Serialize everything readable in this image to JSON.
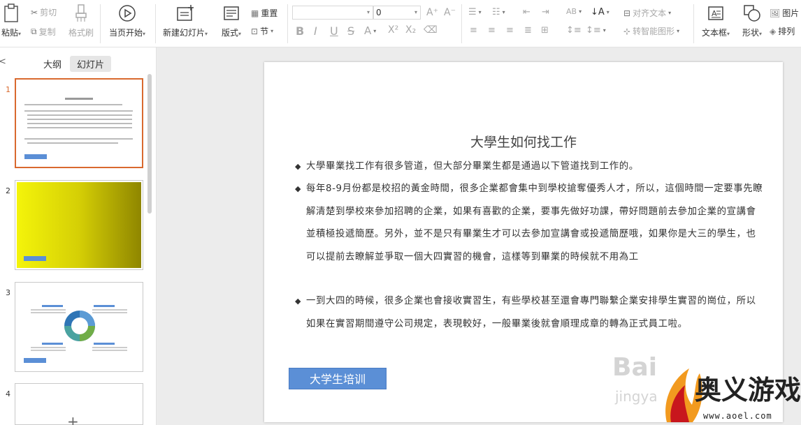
{
  "ribbon": {
    "paste": "粘贴",
    "cut": "剪切",
    "copy": "复制",
    "format_painter": "格式刷",
    "play_from_current": "当页开始",
    "new_slide": "新建幻灯片",
    "layout": "版式",
    "reset": "重置",
    "section": "节",
    "font_size": "0",
    "align_text": "对齐文本",
    "smart_art": "转智能图形",
    "text_box": "文本框",
    "shape": "形状",
    "picture": "图片",
    "arrange": "排列"
  },
  "panel": {
    "collapse": "<",
    "tabs": [
      "大纲",
      "幻灯片"
    ],
    "active_tab": "幻灯片",
    "slide_numbers": [
      "1",
      "2",
      "3",
      "4"
    ],
    "selected_slide": "1",
    "thumb_button": "大学生培训",
    "add_slide": "+"
  },
  "slide": {
    "title": "大學生如何找工作",
    "bullet_symbol": "◆",
    "bullets": [
      "大學畢業找工作有很多管道，但大部分畢業生都是通過以下管道找到工作的。",
      "每年8-9月份都是校招的黃金時間，很多企業都會集中到學校搶奪優秀人才，所以，這個時間一定要事先瞭解清楚到學校來參加招聘的企業，如果有喜歡的企業，要事先做好功課，帶好問題前去參加企業的宣講會並積極投遞簡歷。另外，並不是只有畢業生才可以去參加宣講會或投遞簡歷哦，如果你是大三的學生，也可以提前去瞭解並爭取一個大四實習的機會，這樣等到畢業的時候就不用為工",
      "一到大四的時候，很多企業也會接收實習生，有些學校甚至還會專門聯繫企業安排學生實習的崗位，所以如果在實習期間遵守公司規定，表現較好，一般畢業後就會順理成章的轉為正式員工啦。"
    ],
    "button": "大学生培训"
  },
  "watermark": {
    "baidu": "Bai",
    "jingyan": "jingya",
    "site_name": "奥义游戏网",
    "site_url": "www.aoel.com"
  },
  "colors": {
    "accent_button": "#5b8fd6",
    "selected_border": "#d9692e",
    "workspace_bg": "#ececec",
    "logo_red": "#c8161d",
    "logo_orange": "#f29a1f"
  }
}
